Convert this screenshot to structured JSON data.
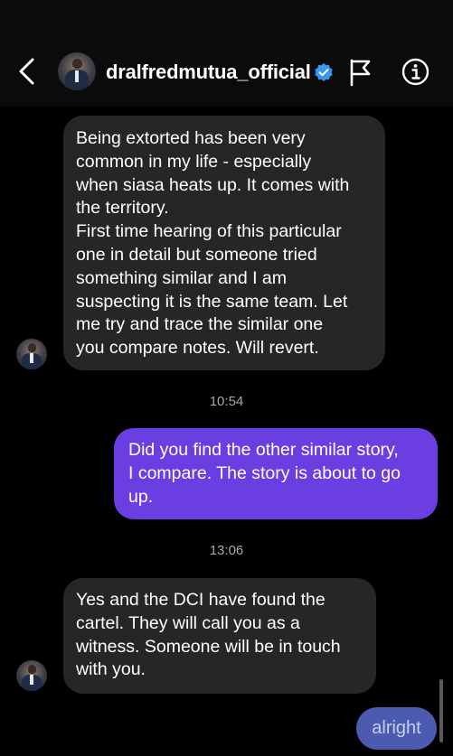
{
  "header": {
    "username": "dralfredmutua_official",
    "icons": [
      "chevron-left-icon",
      "verified-badge-icon",
      "flag-icon",
      "info-icon"
    ]
  },
  "messages": [
    {
      "direction": "incoming",
      "text": "Being extorted has been very\ncommon in my life - especially\nwhen siasa heats up. It comes with\nthe territory.\nFirst time hearing of this particular\none in detail but someone tried\nsomething similar and I am\nsuspecting it is the same team. Let\nme try and trace the similar one\nyou compare notes. Will revert."
    },
    {
      "timestamp": "10:54"
    },
    {
      "direction": "outgoing",
      "text": "Did you find the other similar story,\nI compare. The story is about to go\nup."
    },
    {
      "timestamp": "13:06"
    },
    {
      "direction": "incoming",
      "text": "Yes and the DCI have found the\ncartel. They will call you as a\nwitness. Someone will be in touch\nwith you."
    },
    {
      "direction": "outgoing",
      "text": "alright"
    }
  ],
  "colors": {
    "background": "#000000",
    "incoming_bubble": "#262626",
    "outgoing_bubble": "#6a3ee0",
    "verified_badge": "#3897f0"
  }
}
